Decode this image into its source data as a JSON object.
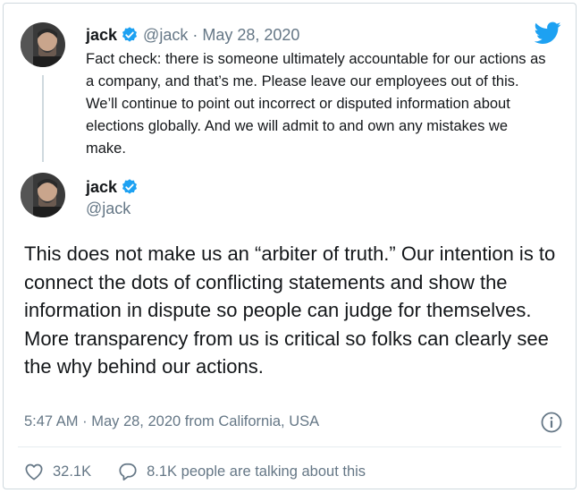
{
  "parent_tweet": {
    "name": "jack",
    "handle": "@jack",
    "separator": "·",
    "date": "May 28, 2020",
    "text": "Fact check: there is someone ultimately accountable for our actions as a company, and that’s me. Please leave our employees out of this. We’ll continue to point out incorrect or disputed information about elections globally. And we will admit to and own any mistakes we make."
  },
  "main_tweet": {
    "name": "jack",
    "handle": "@jack",
    "text": "This does not make us an “arbiter of truth.” Our intention is to connect the dots of conflicting statements and show the information in dispute so people can judge for themselves. More transparency from us is critical so folks can clearly see the why behind our actions.",
    "timestamp": "5:47 AM · May 28, 2020 from California, USA"
  },
  "engagement": {
    "likes": "32.1K",
    "talking": "8.1K people are talking about this"
  },
  "icons": {
    "logo": "twitter-bird-icon",
    "verified": "verified-badge-icon",
    "info": "info-icon",
    "like": "heart-icon",
    "reply": "speech-bubble-icon"
  },
  "colors": {
    "brand": "#1da1f2",
    "text": "#14171a",
    "muted": "#657786"
  }
}
